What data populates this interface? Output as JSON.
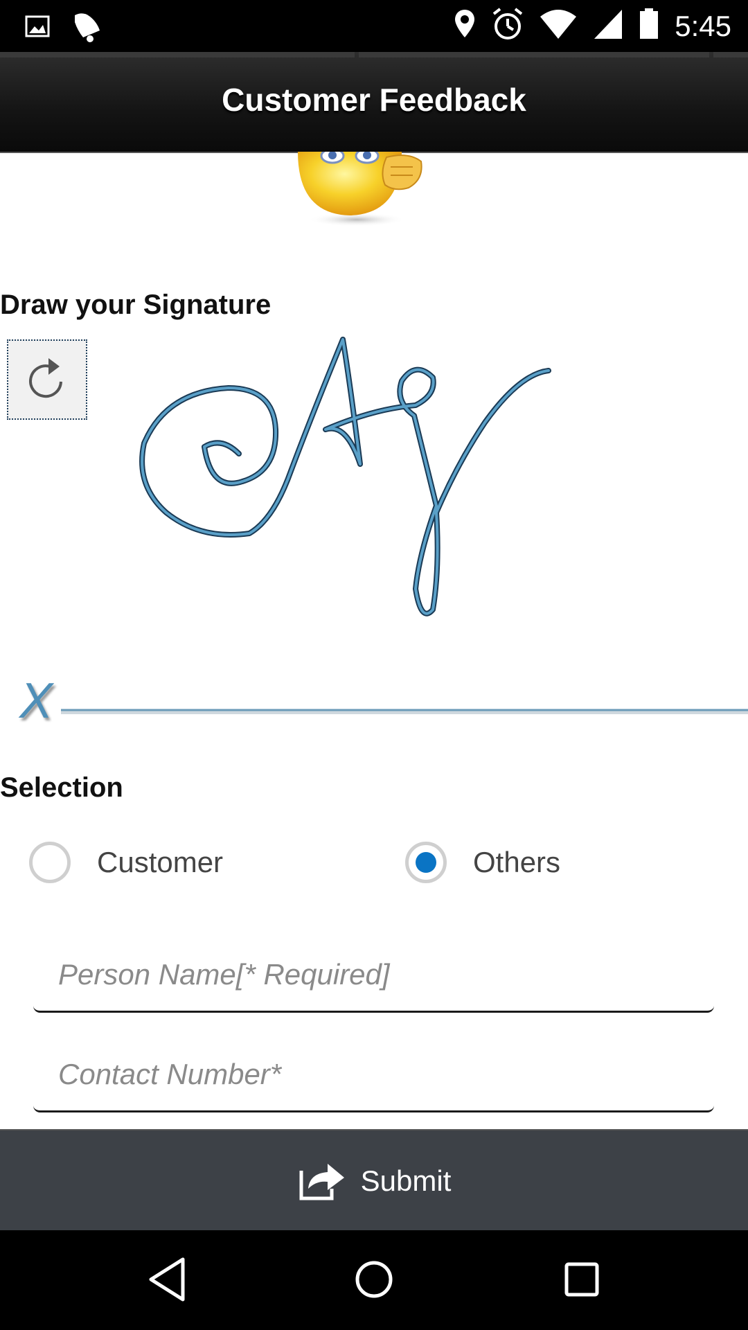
{
  "status_bar": {
    "time": "5:45",
    "left_icons": [
      "image-icon",
      "notification-bell-icon"
    ],
    "right_icons": [
      "location-pin-icon",
      "alarm-clock-icon",
      "wifi-icon",
      "cell-signal-icon",
      "battery-icon"
    ]
  },
  "header": {
    "title": "Customer Feedback"
  },
  "signature": {
    "heading": "Draw your Signature",
    "line_mark": "X"
  },
  "selection": {
    "heading": "Selection",
    "options": [
      {
        "label": "Customer",
        "selected": false
      },
      {
        "label": "Others",
        "selected": true
      }
    ]
  },
  "form": {
    "person_name": {
      "value": "",
      "placeholder": "Person Name[* Required]"
    },
    "contact_number": {
      "value": "",
      "placeholder": "Contact Number*"
    }
  },
  "submit": {
    "label": "Submit",
    "icon": "share-icon"
  },
  "nav": {
    "buttons": [
      "back-icon",
      "home-icon",
      "recents-icon"
    ]
  },
  "colors": {
    "accent": "#0a74c4",
    "signature_stroke": "#4a90b8",
    "submit_bar": "#3d4147"
  }
}
